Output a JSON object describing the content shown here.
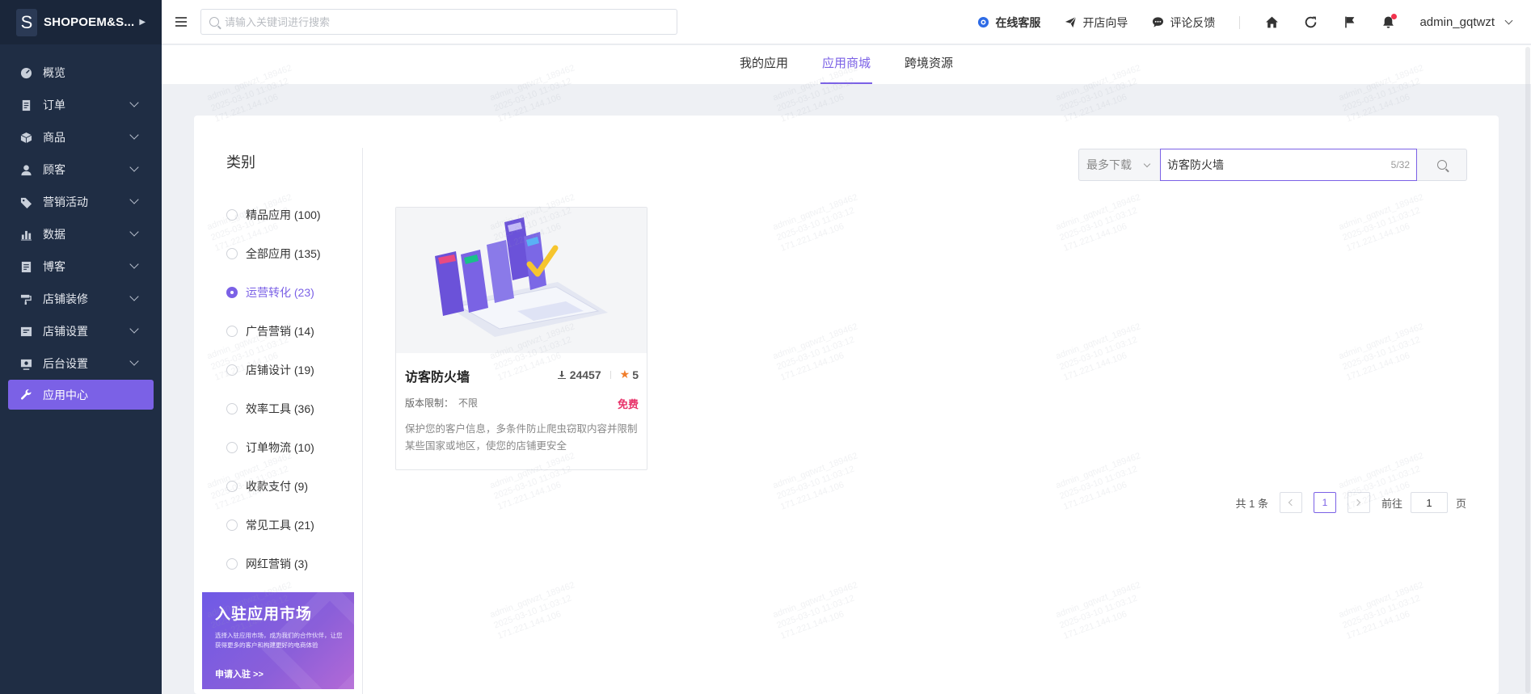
{
  "brand": {
    "logo_letter": "S",
    "name": "SHOPOEM&S..."
  },
  "sidebar": {
    "items": [
      {
        "label": "概览",
        "icon": "dashboard-icon",
        "expandable": false
      },
      {
        "label": "订单",
        "icon": "order-icon",
        "expandable": true
      },
      {
        "label": "商品",
        "icon": "product-icon",
        "expandable": true
      },
      {
        "label": "顾客",
        "icon": "customer-icon",
        "expandable": true
      },
      {
        "label": "营销活动",
        "icon": "tag-icon",
        "expandable": true
      },
      {
        "label": "数据",
        "icon": "chart-icon",
        "expandable": true
      },
      {
        "label": "博客",
        "icon": "blog-icon",
        "expandable": true
      },
      {
        "label": "店铺装修",
        "icon": "paint-roller-icon",
        "expandable": true
      },
      {
        "label": "店铺设置",
        "icon": "store-settings-icon",
        "expandable": true
      },
      {
        "label": "后台设置",
        "icon": "admin-settings-icon",
        "expandable": true
      },
      {
        "label": "应用中心",
        "icon": "wrench-icon",
        "expandable": false,
        "active": true
      }
    ]
  },
  "topbar": {
    "search_placeholder": "请输入关键词进行搜索",
    "links": {
      "support": "在线客服",
      "guide": "开店向导",
      "feedback": "评论反馈"
    },
    "user": "admin_gqtwzt"
  },
  "tabs": [
    {
      "label": "我的应用",
      "active": false
    },
    {
      "label": "应用商城",
      "active": true
    },
    {
      "label": "跨境资源",
      "active": false
    }
  ],
  "categories": {
    "title": "类别",
    "items": [
      {
        "label": "精品应用 (100)",
        "active": false
      },
      {
        "label": "全部应用 (135)",
        "active": false
      },
      {
        "label": "运营转化 (23)",
        "active": true
      },
      {
        "label": "广告营销 (14)",
        "active": false
      },
      {
        "label": "店铺设计 (19)",
        "active": false
      },
      {
        "label": "效率工具 (36)",
        "active": false
      },
      {
        "label": "订单物流 (10)",
        "active": false
      },
      {
        "label": "收款支付 (9)",
        "active": false
      },
      {
        "label": "常见工具 (21)",
        "active": false
      },
      {
        "label": "网红营销 (3)",
        "active": false
      }
    ]
  },
  "banner": {
    "title": "入驻应用市场",
    "desc": "选择入驻应用市场，成为我们的合作伙伴，让您获得更多的客户和构建更好的电商体验",
    "link": "申请入驻 >>"
  },
  "filter": {
    "sort": "最多下载",
    "keyword": "访客防火墙",
    "count": "5/32"
  },
  "apps": [
    {
      "name": "访客防火墙",
      "downloads": "24457",
      "rating": "5",
      "limit_label": "版本限制：",
      "limit_value": "不限",
      "price": "免费",
      "desc": "保护您的客户信息，多条件防止爬虫窃取内容并限制某些国家或地区，使您的店铺更安全"
    }
  ],
  "pagination": {
    "total": "共 1 条",
    "current": "1",
    "goto_prefix": "前往",
    "goto_value": "1",
    "goto_suffix": "页"
  },
  "watermark": [
    "admin_gqtwzt_189462",
    "2025-03-10 11:03:12",
    "171.221.144.106"
  ],
  "colors": {
    "accent": "#7b61e6",
    "sidebar_bg": "#1f2d44",
    "price": "#e8336a",
    "star": "#f07d2b"
  }
}
